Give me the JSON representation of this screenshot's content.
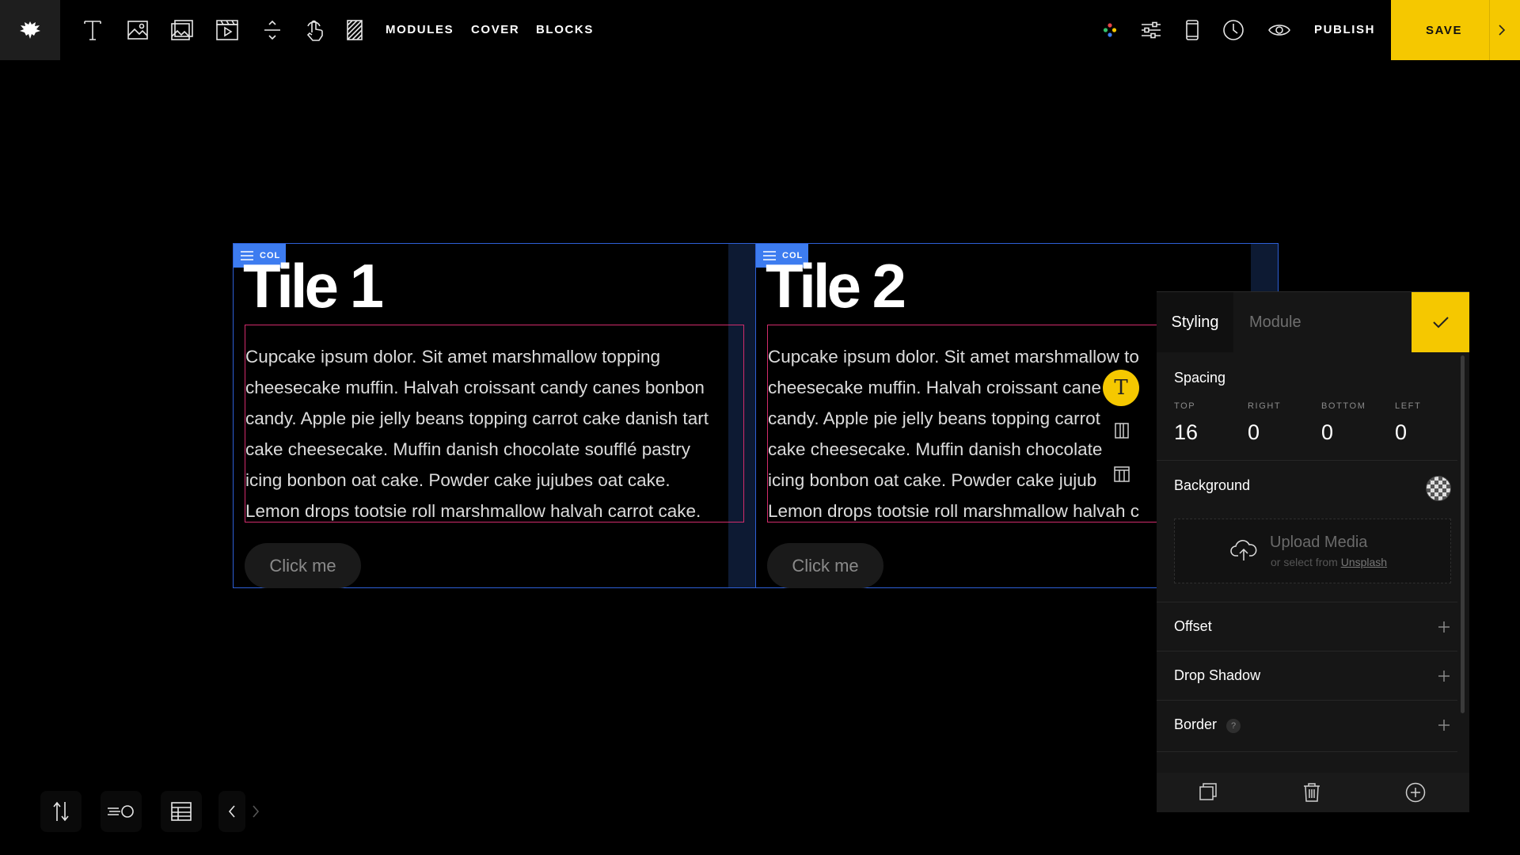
{
  "topbar": {
    "nav": [
      "MODULES",
      "COVER",
      "BLOCKS"
    ],
    "publish_label": "PUBLISH",
    "save_label": "SAVE",
    "accent_color": "#f5c800"
  },
  "tiles": [
    {
      "col_tag": "COL",
      "title": "Tile 1",
      "lines": [
        "Cupcake ipsum dolor. Sit amet marshmallow topping",
        "cheesecake muffin. Halvah croissant candy canes bonbon",
        "candy. Apple pie jelly beans topping carrot cake danish tart",
        "cake cheesecake. Muffin danish chocolate soufflé pastry",
        "icing bonbon oat cake. Powder cake jujubes oat cake.",
        "Lemon drops tootsie roll marshmallow halvah carrot cake."
      ],
      "button": "Click me"
    },
    {
      "col_tag": "COL",
      "title": "Tile 2",
      "lines": [
        "Cupcake ipsum dolor. Sit amet marshmallow to",
        "cheesecake muffin. Halvah croissant cane",
        "candy. Apple pie jelly beans topping carrot",
        "cake cheesecake. Muffin danish chocolate",
        "icing bonbon oat cake. Powder cake jujub",
        "Lemon drops tootsie roll marshmallow halvah c"
      ],
      "button": "Click me"
    }
  ],
  "floating": {
    "text_tool_glyph": "T"
  },
  "panel": {
    "tab_active": "Styling",
    "tab_inactive": "Module",
    "spacing": {
      "title": "Spacing",
      "labels": [
        "TOP",
        "RIGHT",
        "BOTTOM",
        "LEFT"
      ],
      "values": [
        "16",
        "0",
        "0",
        "0"
      ]
    },
    "background": {
      "title": "Background",
      "upload_title": "Upload Media",
      "upload_sub": "or select from",
      "upload_link": "Unsplash"
    },
    "offset": "Offset",
    "drop_shadow": "Drop Shadow",
    "border": "Border",
    "border_help": "?"
  }
}
